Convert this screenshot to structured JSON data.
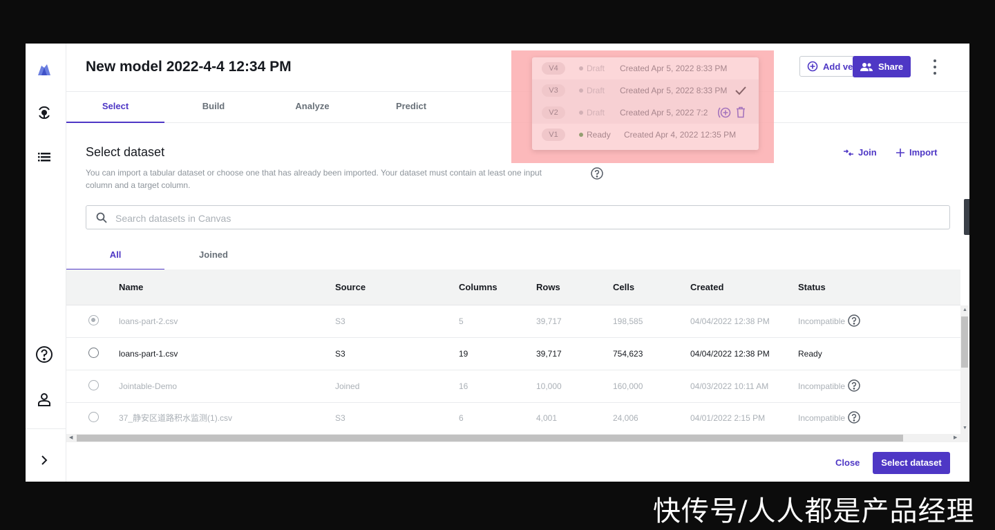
{
  "header": {
    "title": "New model 2022-4-4 12:34 PM",
    "add_version_label": "Add version",
    "share_label": "Share"
  },
  "tabs": [
    {
      "label": "Select",
      "active": true
    },
    {
      "label": "Build",
      "active": false
    },
    {
      "label": "Analyze",
      "active": false
    },
    {
      "label": "Predict",
      "active": false
    }
  ],
  "versions_menu": [
    {
      "version": "V4",
      "status": "Draft",
      "created": "Created Apr 5, 2022 8:33 PM"
    },
    {
      "version": "V3",
      "status": "Draft",
      "created": "Created Apr 5, 2022 8:33 PM"
    },
    {
      "version": "V2",
      "status": "Draft",
      "created": "Created Apr 5, 2022 7:2"
    },
    {
      "version": "V1",
      "status": "Ready",
      "created": "Created Apr 4, 2022 12:35 PM"
    }
  ],
  "section": {
    "title": "Select dataset",
    "description": "You can import a tabular dataset or choose one that has already been imported. Your dataset must contain at least one input column and a target column.",
    "join_label": "Join",
    "import_label": "Import"
  },
  "search": {
    "placeholder": "Search datasets in Canvas",
    "value": ""
  },
  "subtabs": [
    {
      "label": "All",
      "active": true
    },
    {
      "label": "Joined",
      "active": false
    }
  ],
  "table": {
    "columns": [
      "Name",
      "Source",
      "Columns",
      "Rows",
      "Cells",
      "Created",
      "Status"
    ],
    "rows": [
      {
        "name": "loans-part-2.csv",
        "source": "S3",
        "columns": "5",
        "rows": "39,717",
        "cells": "198,585",
        "created": "04/04/2022 12:38 PM",
        "status": "Incompatible",
        "selected": true,
        "dim": true
      },
      {
        "name": "loans-part-1.csv",
        "source": "S3",
        "columns": "19",
        "rows": "39,717",
        "cells": "754,623",
        "created": "04/04/2022 12:38 PM",
        "status": "Ready",
        "selected": false,
        "dim": false
      },
      {
        "name": "Jointable-Demo",
        "source": "Joined",
        "columns": "16",
        "rows": "10,000",
        "cells": "160,000",
        "created": "04/03/2022 10:11 AM",
        "status": "Incompatible",
        "selected": false,
        "dim": true
      },
      {
        "name": "37_静安区道路积水监测(1).csv",
        "source": "S3",
        "columns": "6",
        "rows": "4,001",
        "cells": "24,006",
        "created": "04/01/2022 2:15 PM",
        "status": "Incompatible",
        "selected": false,
        "dim": true
      }
    ]
  },
  "footer": {
    "close_label": "Close",
    "select_label": "Select dataset"
  },
  "watermark": "快传号/人人都是产品经理",
  "colors": {
    "accent": "#4e37c5",
    "highlight": "#ffaaaa",
    "ready_dot": "#2e8b2e"
  },
  "icons": [
    "logo-icon",
    "models-icon",
    "datasets-list-icon",
    "help-icon",
    "user-icon",
    "expand-chevron-icon",
    "add-circle-icon",
    "people-icon",
    "more-vertical-icon",
    "join-icon",
    "plus-icon",
    "search-icon",
    "question-icon",
    "checkmark-icon",
    "add-version-icon",
    "trash-icon"
  ]
}
